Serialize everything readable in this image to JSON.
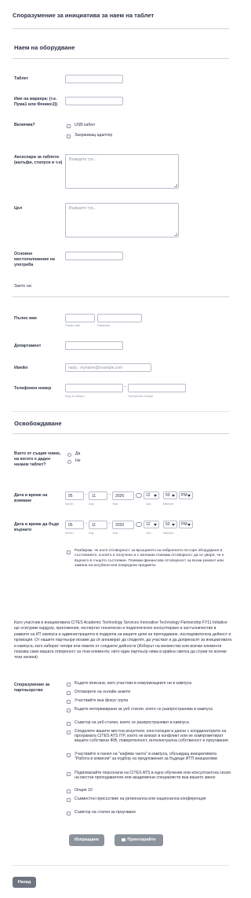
{
  "form_title": "Споразумение за инициатива за наем на таблет",
  "section_rental": {
    "title": "Наем на оборудване",
    "tablet_label": "Таблет",
    "marker_label": "Име на маркера: (т.е. Пума1 или Феникс2))",
    "includes_label": "Включва?",
    "includes_options": [
      "USB кабел",
      "Захранващ адаптер"
    ],
    "accessories_label": "Аксесоари за таблети (калъфи, стилуси и т.н)",
    "accessories_placeholder": "Въведете тук...",
    "purpose_label": "Цел",
    "purpose_placeholder": "Въведете тук...",
    "location_label": "Основно местоположение на употреба",
    "borrowed_by_label": "Заето на:",
    "full_name_label": "Пълно име",
    "first_name_sub": "Първо име",
    "last_name_sub": "Фамилия",
    "department_label": "Департамент",
    "email_label": "Имейл",
    "email_placeholder": "напр.: myname@example.com",
    "phone_label": "Телефонен номер",
    "area_code_sub": "Код на област",
    "phone_sub": "Телефонен номер",
    "phone_dash": "-"
  },
  "section_release": {
    "title": "Освобождаване",
    "same_person_label": "Взето от същия човек, на когото е даден назаем таблет?",
    "same_person_options": [
      "Да",
      "Не"
    ],
    "pickup_label": "Дата и време на взимане",
    "return_label": "Дата и време да бъде върнато",
    "pickup": {
      "month": "05",
      "day": "11",
      "year": "2026",
      "hour": "12",
      "minute": "50",
      "ampm": "PM"
    },
    "return": {
      "month": "05",
      "day": "11",
      "year": "2026",
      "hour": "12",
      "minute": "50",
      "ampm": "PM"
    },
    "month_sub": "Month",
    "day_sub": "Day",
    "year_sub": "Year",
    "hour_sub": "Час",
    "minute_sub": "Минути",
    "date_dash": "-",
    "responsibility_text": "Разбирам, че нося отговорност за връщането на изброеното по-горе оборудване в състоянието, в което е получено и с желание поемам отговорност да се уверя, че е върнато в същото състояние. Поемам финансова отговорност за всеки ремонт или замяна на изгубени или повредени предмети."
  },
  "partnership_paragraph": "Като участник в инициативата CITES Academic Technology Services Innovative Technology Partnership FY11 Initiative ще осигурим хардуер, приложения, експертно техническо и педагогическо консултиране и застъпничество в рамките на ИТ кампуса и администрацията в подкрепа на вашите цели на преподаване, изследователска дейност и промоция. От нашите партньори искаме да сё ангажират да споделят, да участват и да допринасят за инициативата и кампуса, като избират четири или повече от следните дейности (Изборът на множество или всички елементи показва само вашата отвореност за тези елементи; нито един партньор няма в крайна сметка да служи по всички тези начини)",
  "partnership": {
    "label": "Споразумение за партньорство",
    "options": [
      "Бъдете вписани, като участник в комуникациите ни в кампуса",
      "Отговорете на онлайн анкети",
      "Участвайте във фокус група",
      "Бъдете интервюирани за уеб статия, която се разпространява в кампуса",
      "Съветор на уеб-статия, които се разпространяват в кампуса",
      "Споделете вашите местни резултати, констатации и данни с координаторите на програмата CITES ATS ITP, които не влизат в конфликт или не компрометират вашите собствени IRB, поверителност, интелектуална собственост и проучвания",
      "Участвайте в панел на \"кафява чанта\" в кампуса, обсъждащ инициативата \"Работа в комисия\" за подбор на предложения за бъдещи ИТП инициативи",
      "Подпомагайте персонала на CITES ATS в едно обучение или консултантска сесия на местни преподаватели или академични специалисти във вашето звено",
      "Опция 10",
      "Съвместно присъствие на регионална или национална конференция",
      "Съветор на статия за проучване"
    ]
  },
  "buttons": {
    "submit": "Изпращане",
    "print": "Принтирайте форма",
    "back": "Назад"
  },
  "colors": {
    "text": "#2c3345",
    "border": "#b8bdc9",
    "button": "#8c939d"
  }
}
